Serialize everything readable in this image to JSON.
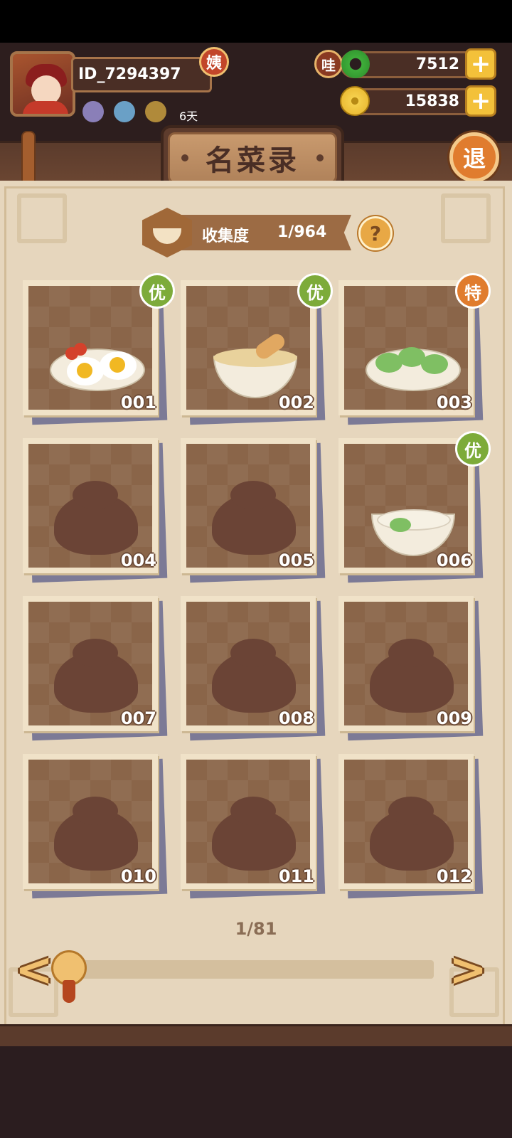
{
  "profile": {
    "user_id": "ID_7294397",
    "role_badge": "姨",
    "days": "6天",
    "mini_icons": [
      "character-icon",
      "food-icon",
      "tool-icon"
    ]
  },
  "currency": {
    "jade_label": "哇",
    "jade_amount": "7512",
    "gold_amount": "15838",
    "plus_label": "+"
  },
  "header": {
    "title": "名菜录",
    "exit_label": "退"
  },
  "collection": {
    "label": "收集度",
    "count": "1/964",
    "help_label": "?"
  },
  "dishes": [
    {
      "num": "001",
      "grade": "优",
      "unlocked": true
    },
    {
      "num": "002",
      "grade": "优",
      "unlocked": true
    },
    {
      "num": "003",
      "grade": "特",
      "unlocked": true
    },
    {
      "num": "004",
      "grade": "",
      "unlocked": false
    },
    {
      "num": "005",
      "grade": "",
      "unlocked": false
    },
    {
      "num": "006",
      "grade": "优",
      "unlocked": true
    },
    {
      "num": "007",
      "grade": "",
      "unlocked": false
    },
    {
      "num": "008",
      "grade": "",
      "unlocked": false
    },
    {
      "num": "009",
      "grade": "",
      "unlocked": false
    },
    {
      "num": "010",
      "grade": "",
      "unlocked": false
    },
    {
      "num": "011",
      "grade": "",
      "unlocked": false
    },
    {
      "num": "012",
      "grade": "",
      "unlocked": false
    }
  ],
  "pagination": {
    "page": "1/81",
    "prev_label": "<",
    "next_label": ">"
  },
  "colors": {
    "grade_good": "#7dab3a",
    "grade_special": "#e07c2e",
    "panel": "#e6d6bd"
  }
}
